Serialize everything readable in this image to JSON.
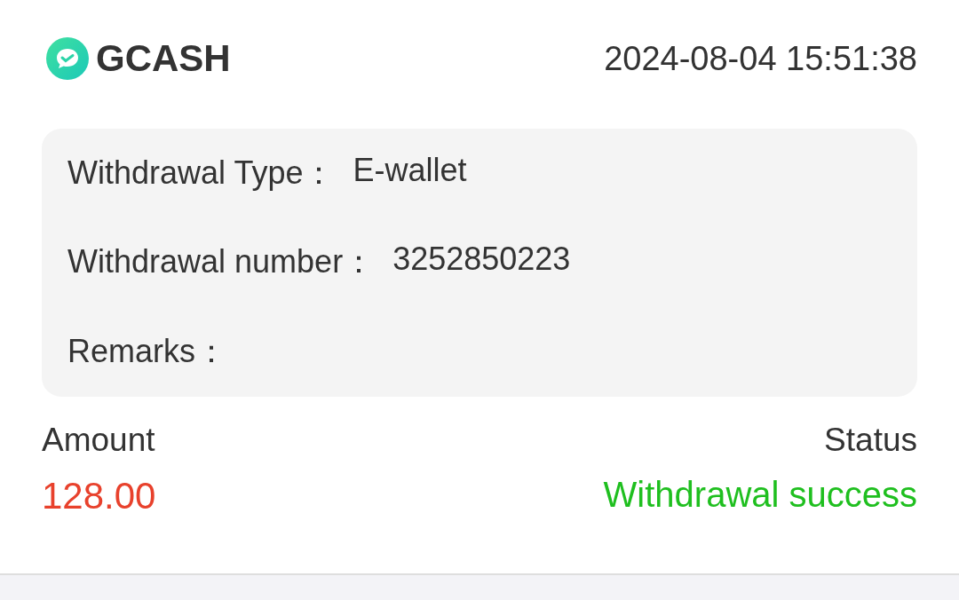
{
  "brand": {
    "name": "GCASH"
  },
  "timestamp": "2024-08-04 15:51:38",
  "details": [
    {
      "label": "Withdrawal Type：",
      "value": "E-wallet"
    },
    {
      "label": "Withdrawal number：",
      "value": "3252850223"
    },
    {
      "label": "Remarks："
    }
  ],
  "amount": {
    "label": "Amount",
    "value": "128.00"
  },
  "status": {
    "label": "Status",
    "value": "Withdrawal success",
    "kind": "success"
  }
}
